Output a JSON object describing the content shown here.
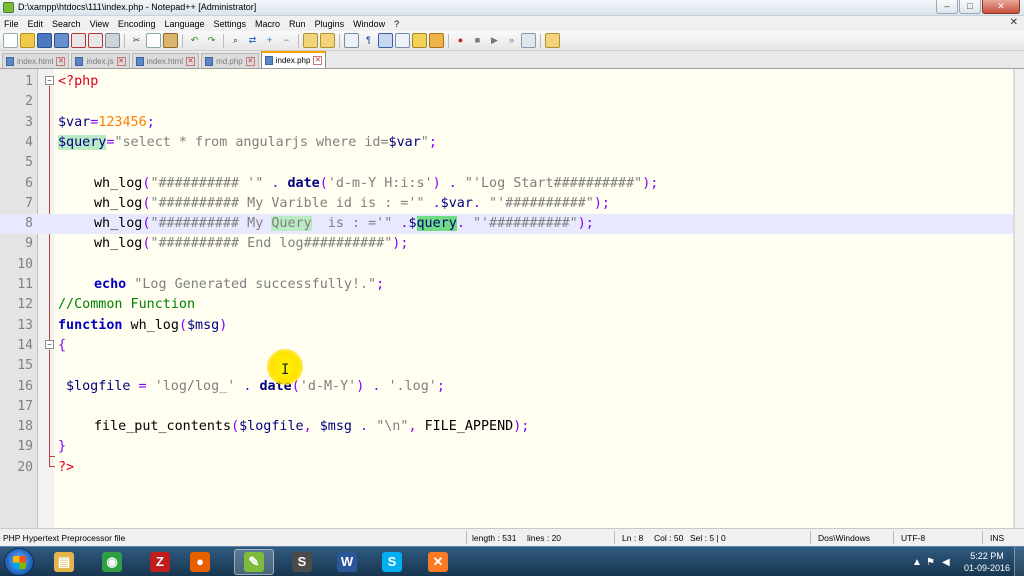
{
  "window": {
    "title": "D:\\xampp\\htdocs\\111\\index.php - Notepad++ [Administrator]",
    "minimize_glyph": "–",
    "maximize_glyph": "□",
    "close_glyph": "✕"
  },
  "menu": {
    "items": [
      "File",
      "Edit",
      "Search",
      "View",
      "Encoding",
      "Language",
      "Settings",
      "Macro",
      "Run",
      "Plugins",
      "Window",
      "?"
    ],
    "close_glyph": "✕"
  },
  "toolbar": {
    "icons": [
      "new-file-icon",
      "open-file-icon",
      "save-icon",
      "save-all-icon",
      "close-icon",
      "close-all-icon",
      "print-icon",
      "cut-icon",
      "copy-icon",
      "paste-icon",
      "undo-icon",
      "redo-icon",
      "find-icon",
      "replace-icon",
      "zoom-in-icon",
      "zoom-out-icon",
      "sync-vertical-icon",
      "sync-horizontal-icon",
      "word-wrap-icon",
      "all-characters-icon",
      "indent-guide-icon",
      "user-language-icon",
      "doc-map-icon",
      "function-list-icon",
      "record-macro-icon",
      "stop-macro-icon",
      "play-macro-icon",
      "run-macro-icon",
      "save-macro-icon",
      "plugin-icon"
    ]
  },
  "tabs": [
    {
      "label": "index.html",
      "active": false
    },
    {
      "label": "index.js",
      "active": false
    },
    {
      "label": "index.html",
      "active": false
    },
    {
      "label": "md.php",
      "active": false
    },
    {
      "label": "index.php",
      "active": true
    }
  ],
  "editor": {
    "line_numbers": [
      "1",
      "2",
      "3",
      "4",
      "5",
      "6",
      "7",
      "8",
      "9",
      "10",
      "11",
      "12",
      "13",
      "14",
      "15",
      "16",
      "17",
      "18",
      "19",
      "20"
    ],
    "current_line": 8,
    "code": {
      "l1_tag": "<?php",
      "l3_var": "$var",
      "l3_op": "=",
      "l3_num": "123456",
      "l3_semi": ";",
      "l4_var": "$query",
      "l4_op": "=",
      "l4_str": "\"select * from angularjs where id=",
      "l4_var2": "$var",
      "l4_str2": "\"",
      "l4_semi": ";",
      "l6_fn": "wh_log",
      "l6_p1": "(",
      "l6_s1": "\"########## '\"",
      "l6_dot1": " . ",
      "l6_date": "date",
      "l6_p2": "(",
      "l6_s2": "'d-m-Y H:i:s'",
      "l6_p3": ")",
      "l6_dot2": " . ",
      "l6_s3": "\"'Log Start##########\"",
      "l6_end": ");",
      "l7_fn": "wh_log",
      "l7_p1": "(",
      "l7_s1": "\"########## My Varible id is : ='\"",
      "l7_dot1": " .",
      "l7_var": "$var",
      "l7_dot2": ". ",
      "l7_s2": "\"'##########\"",
      "l7_end": ");",
      "l8_fn": "wh_log",
      "l8_p1": "(",
      "l8_s1a": "\"########## My ",
      "l8_s1b": "Query",
      "l8_s1c": "  is : ='\"",
      "l8_dot1": " .",
      "l8_var_a": "$",
      "l8_var_b": "query",
      "l8_dot2": ". ",
      "l8_s2": "\"'##########\"",
      "l8_end": ");",
      "l9_fn": "wh_log",
      "l9_p1": "(",
      "l9_s1": "\"########## End log##########\"",
      "l9_end": ");",
      "l11_kw": "echo",
      "l11_str": " \"Log Generated successfully!.\"",
      "l11_semi": ";",
      "l12_cmt": "//Common Function",
      "l13_kw": "function",
      "l13_name": " wh_log",
      "l13_p1": "(",
      "l13_var": "$msg",
      "l13_p2": ")",
      "l14_brace": "{",
      "l16_var": "$logfile",
      "l16_op": " = ",
      "l16_s1": "'log/log_'",
      "l16_dot1": " . ",
      "l16_date": "date",
      "l16_p1": "(",
      "l16_s2": "'d-M-Y'",
      "l16_p2": ")",
      "l16_dot2": " . ",
      "l16_s3": "'.log'",
      "l16_semi": ";",
      "l18_fn": "file_put_contents",
      "l18_p1": "(",
      "l18_var1": "$logfile",
      "l18_comma": ", ",
      "l18_var2": "$msg",
      "l18_dot": " . ",
      "l18_s1": "\"\\n\"",
      "l18_comma2": ", ",
      "l18_const": "FILE_APPEND",
      "l18_end": ");",
      "l19_brace": "}",
      "l20_tag": "?>"
    }
  },
  "statusbar": {
    "filetype": "PHP Hypertext Preprocessor file",
    "length": "length : 531",
    "lines": "lines : 20",
    "ln": "Ln : 8",
    "col": "Col : 50",
    "sel": "Sel : 5 | 0",
    "eol": "Dos\\Windows",
    "encoding": "UTF-8",
    "mode": "INS"
  },
  "taskbar": {
    "apps": [
      {
        "name": "explorer-icon",
        "glyph": "▤",
        "color": "#e2b44a",
        "active": false
      },
      {
        "name": "chrome-icon",
        "glyph": "◉",
        "color": "#2f9e44",
        "active": false
      },
      {
        "name": "filezilla-icon",
        "glyph": "Z",
        "color": "#bf1e1e",
        "active": false
      },
      {
        "name": "firefox-icon",
        "glyph": "●",
        "color": "#e66000",
        "active": false
      },
      {
        "name": "notepadpp-icon",
        "glyph": "✎",
        "color": "#7dbb3c",
        "active": true
      },
      {
        "name": "sublime-icon",
        "glyph": "S",
        "color": "#4b4b4b",
        "active": false
      },
      {
        "name": "word-icon",
        "glyph": "W",
        "color": "#2b579a",
        "active": false
      },
      {
        "name": "skype-icon",
        "glyph": "S",
        "color": "#00aff0",
        "active": false
      },
      {
        "name": "xampp-icon",
        "glyph": "✕",
        "color": "#fb7a24",
        "active": false
      }
    ],
    "clock_time": "5:22 PM",
    "clock_date": "01-09-2016"
  }
}
